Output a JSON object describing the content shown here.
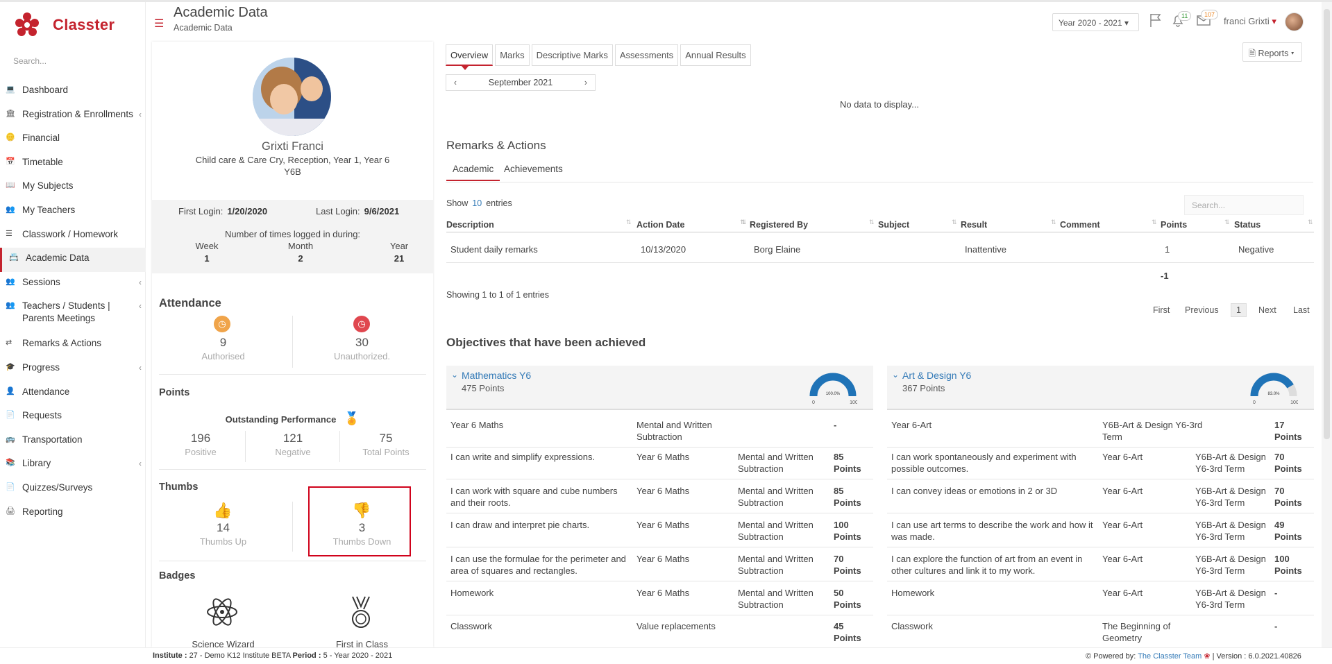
{
  "app": {
    "name": "Classter"
  },
  "sidebar": {
    "search_placeholder": "Search...",
    "items": [
      {
        "label": "Dashboard",
        "icon": "laptop-icon"
      },
      {
        "label": "Registration & Enrollments",
        "icon": "institution-icon"
      },
      {
        "label": "Financial",
        "icon": "coins-icon"
      },
      {
        "label": "Timetable",
        "icon": "calendar-icon"
      },
      {
        "label": "My Subjects",
        "icon": "book-icon"
      },
      {
        "label": "My Teachers",
        "icon": "users-icon"
      },
      {
        "label": "Classwork / Homework",
        "icon": "list-icon"
      },
      {
        "label": "Academic Data",
        "icon": "id-card-icon"
      },
      {
        "label": "Sessions",
        "icon": "users-icon"
      },
      {
        "label": "Teachers / Students | Parents Meetings",
        "icon": "users-icon"
      },
      {
        "label": "Remarks & Actions",
        "icon": "shuffle-icon"
      },
      {
        "label": "Progress",
        "icon": "graduation-icon"
      },
      {
        "label": "Attendance",
        "icon": "user-check-icon"
      },
      {
        "label": "Requests",
        "icon": "file-icon"
      },
      {
        "label": "Transportation",
        "icon": "bus-icon"
      },
      {
        "label": "Library",
        "icon": "library-icon"
      },
      {
        "label": "Quizzes/Surveys",
        "icon": "file-icon"
      },
      {
        "label": "Reporting",
        "icon": "print-icon"
      }
    ]
  },
  "header": {
    "title": "Academic Data",
    "subtitle": "Academic Data",
    "year": "Year 2020 - 2021",
    "notif_count": "11",
    "mail_count": "107",
    "user": "franci Grixti"
  },
  "profile": {
    "name": "Grixti Franci",
    "classes": "Child care & Care Cry, Reception, Year 1, Year 6",
    "group": "Y6B",
    "first_login_label": "First Login:",
    "first_login": "1/20/2020",
    "last_login_label": "Last Login:",
    "last_login": "9/6/2021",
    "times_label": "Number of times logged in during:",
    "week_label": "Week",
    "week": "1",
    "month_label": "Month",
    "month": "2",
    "year_label": "Year",
    "year": "21",
    "attendance_title": "Attendance",
    "authorised": "9",
    "authorised_label": "Authorised",
    "unauthorized": "30",
    "unauthorized_label": "Unauthorized.",
    "points_title": "Points",
    "outstanding": "Outstanding Performance",
    "positive": "196",
    "positive_label": "Positive",
    "negative": "121",
    "negative_label": "Negative",
    "total": "75",
    "total_label": "Total Points",
    "thumbs_title": "Thumbs",
    "thumbs_up": "14",
    "thumbs_up_label": "Thumbs Up",
    "thumbs_down": "3",
    "thumbs_down_label": "Thumbs Down",
    "badges_title": "Badges",
    "badge1": "Science Wizard",
    "badge2": "First in Class"
  },
  "main": {
    "tabs": [
      "Overview",
      "Marks",
      "Descriptive Marks",
      "Assessments",
      "Annual Results"
    ],
    "reports": "Reports",
    "month": "September 2021",
    "no_data": "No data to display...",
    "remarks_title": "Remarks & Actions",
    "subtabs": [
      "Academic",
      "Achievements"
    ],
    "show": "Show",
    "entries_n": "10",
    "entries": "entries",
    "search_placeholder": "Search...",
    "columns": [
      "Description",
      "Action Date",
      "Registered By",
      "Subject",
      "Result",
      "Comment",
      "Points",
      "Status"
    ],
    "row": {
      "description": "Student daily remarks",
      "date": "10/13/2020",
      "by": "Borg Elaine",
      "subject": "",
      "result": "Inattentive",
      "comment": "",
      "points": "1",
      "status": "Negative"
    },
    "points_total": "-1",
    "showing": "Showing 1 to 1 of 1 entries",
    "pager": [
      "First",
      "Previous",
      "1",
      "Next",
      "Last"
    ],
    "objectives_title": "Objectives that have been achieved",
    "subjects": [
      {
        "name": "Mathematics Y6",
        "points": "475 Points",
        "gauge": "100.0%",
        "gauge_value": 100,
        "min": "0",
        "max": "100",
        "rows": [
          {
            "a": "Year 6 Maths",
            "b": "Mental and Written Subtraction",
            "c": "",
            "d": "-"
          },
          {
            "a": "I can write and simplify expressions.",
            "b": "Year 6 Maths",
            "c": "Mental and Written Subtraction",
            "d": "85 Points"
          },
          {
            "a": "I can work with square and cube numbers and their roots.",
            "b": "Year 6 Maths",
            "c": "Mental and Written Subtraction",
            "d": "85 Points"
          },
          {
            "a": "I can draw and interpret pie charts.",
            "b": "Year 6 Maths",
            "c": "Mental and Written Subtraction",
            "d": "100 Points"
          },
          {
            "a": "I can use the formulae for the perimeter and area of squares and rectangles.",
            "b": "Year 6 Maths",
            "c": "Mental and Written Subtraction",
            "d": "70 Points"
          },
          {
            "a": "Homework",
            "b": "Year 6 Maths",
            "c": "Mental and Written Subtraction",
            "d": "50 Points"
          },
          {
            "a": "Classwork",
            "b": "Value replacements",
            "c": "",
            "d": "45 Points"
          }
        ]
      },
      {
        "name": "Art & Design Y6",
        "points": "367 Points",
        "gauge": "83.0%",
        "gauge_value": 83,
        "min": "0",
        "max": "100",
        "rows": [
          {
            "a": "Year 6-Art",
            "b": "Y6B-Art & Design Y6-3rd Term",
            "c": "",
            "d": "17 Points"
          },
          {
            "a": "I can work spontaneously and experiment with possible outcomes.",
            "b": "Year 6-Art",
            "c": "Y6B-Art & Design Y6-3rd Term",
            "d": "70 Points"
          },
          {
            "a": "I can convey ideas or emotions in 2 or 3D",
            "b": "Year 6-Art",
            "c": "Y6B-Art & Design Y6-3rd Term",
            "d": "70 Points"
          },
          {
            "a": "I can use art terms to describe the work and how it was made.",
            "b": "Year 6-Art",
            "c": "Y6B-Art & Design Y6-3rd Term",
            "d": "49 Points"
          },
          {
            "a": "I can explore the function of art from an event in other cultures and link it to my work.",
            "b": "Year 6-Art",
            "c": "Y6B-Art & Design Y6-3rd Term",
            "d": "100 Points"
          },
          {
            "a": "Homework",
            "b": "Year 6-Art",
            "c": "Y6B-Art & Design Y6-3rd Term",
            "d": "-"
          },
          {
            "a": "Classwork",
            "b": "The Beginning of Geometry",
            "c": "",
            "d": "-"
          }
        ]
      }
    ]
  },
  "footer": {
    "institute_label": "Institute :",
    "institute": "27 - Demo K12 Institute BETA",
    "period_label": "Period :",
    "period": "5 - Year 2020 - 2021",
    "powered": "Powered by:",
    "team": "The Classter Team",
    "version": "| Version : 6.0.2021.40826"
  }
}
